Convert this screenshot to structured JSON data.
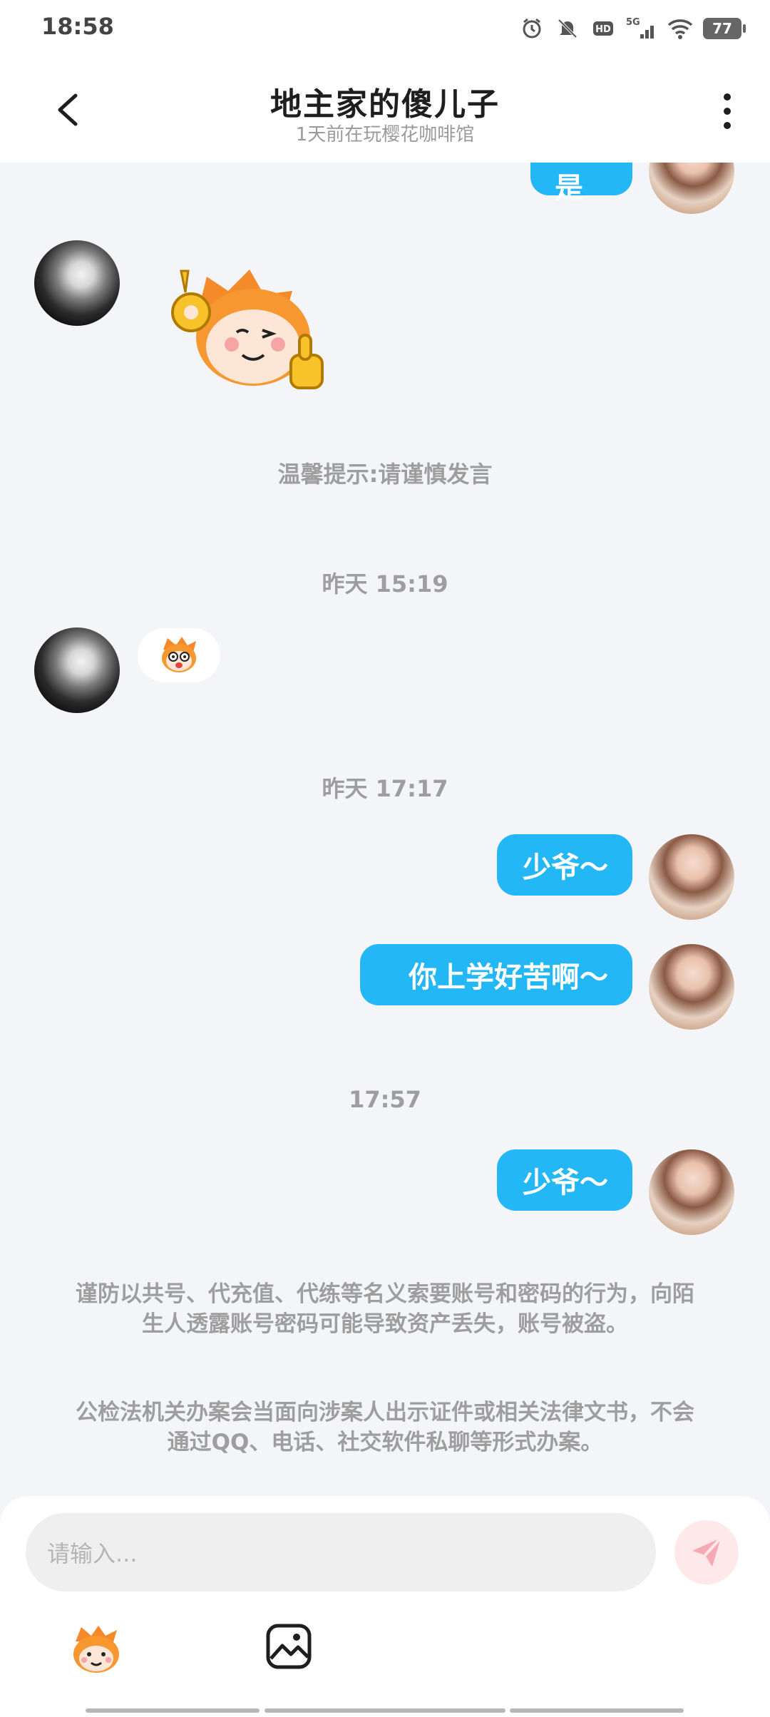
{
  "status": {
    "time": "18:58",
    "battery": "77",
    "network": "5G"
  },
  "header": {
    "title": "地主家的傻儿子",
    "subtitle": "1天前在玩樱花咖啡馆"
  },
  "messages": {
    "top_partial_bubble": "不是",
    "tip": "温馨提示:请谨慎发言",
    "time1": "昨天 15:19",
    "time2": "昨天 17:17",
    "msg1": "少爷～",
    "msg2": "你上学好苦啊～",
    "time3": "17:57",
    "msg3": "少爷～"
  },
  "notices": {
    "p1": "谨防以共号、代充值、代练等名义索要账号和密码的行为，向陌生人透露账号密码可能导致资产丢失，账号被盗。",
    "p2": "公检法机关办案会当面向涉案人出示证件或相关法律文书，不会通过QQ、电话、社交软件私聊等形式办案。"
  },
  "input": {
    "placeholder": "请输入..."
  },
  "colors": {
    "accent": "#23b7f5",
    "send_bg": "#fde8ea",
    "background": "#f3f5f8"
  }
}
